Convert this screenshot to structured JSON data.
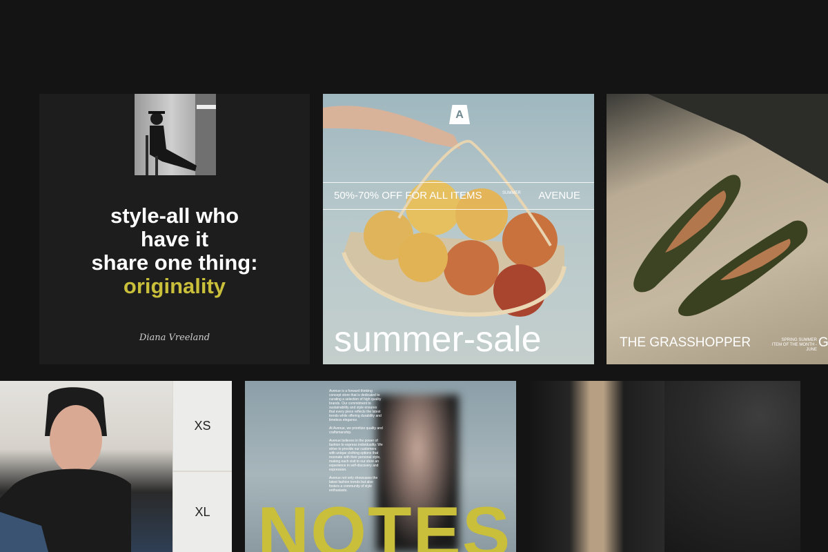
{
  "quote_card": {
    "line1": "style-all who",
    "line2": "have it",
    "line3": "share one thing:",
    "highlight": "originality",
    "signature": "Diana Vreeland",
    "highlight_color": "#c9bf3a"
  },
  "sale_card": {
    "logo_letter": "A",
    "offer": "50%-70% OFF FOR ALL ITEMS",
    "tiny_label": "SUMMER",
    "brand": "AVENUE",
    "headline": "summer-sale"
  },
  "shoe_card": {
    "title": "THE GRASSHOPPER",
    "subtitle_line1": "SPRING SUMMER",
    "subtitle_line2": "ITEM OF THE MONTH - JUNE",
    "cut_letter": "G"
  },
  "size_card": {
    "sizes": [
      "XS",
      "XL"
    ]
  },
  "notes_card": {
    "paragraphs": [
      "Avenue is a forward thinking concept store that is dedicated to curating a selection of high quality brands. Our commitment to sustainability and style ensures that every piece reflects the latest trends while offering durability and timeless elegance.",
      "At Avenue, we prioritize quality and craftsmanship.",
      "Avenue believes in the power of fashion to express individuality. We strive to provide our customers with unique clothing options that resonate with their personal style, making each visit to our store an experience in self-discovery and expression.",
      "Avenue not only showcases the latest fashion trends but also fosters a community of style enthusiasts."
    ],
    "headline": "NOTES"
  }
}
